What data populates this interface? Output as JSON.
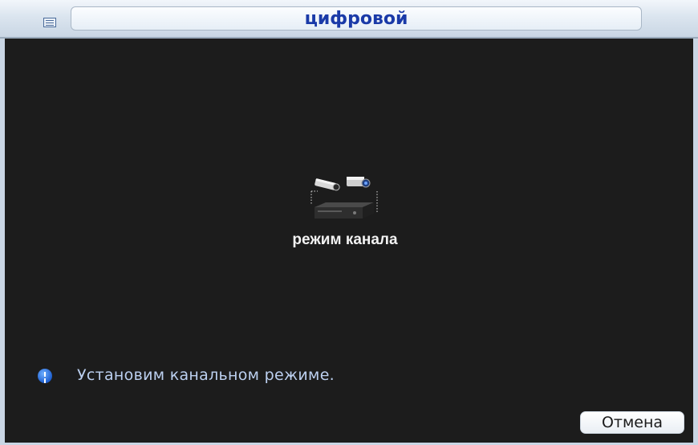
{
  "window": {
    "title": "цифровой",
    "menu_icon": "menu-icon"
  },
  "main": {
    "channel_mode_icon": "camera-dvr-icon",
    "channel_mode_label": "режим канала"
  },
  "status": {
    "info_icon": "info-icon",
    "message": "Установим канальном режиме."
  },
  "actions": {
    "cancel_label": "Отмена"
  },
  "colors": {
    "background": "#1c1c1c",
    "title_text": "#1a3aa8",
    "message_text": "#bcd0f0",
    "frame": "#c9d6e4"
  }
}
